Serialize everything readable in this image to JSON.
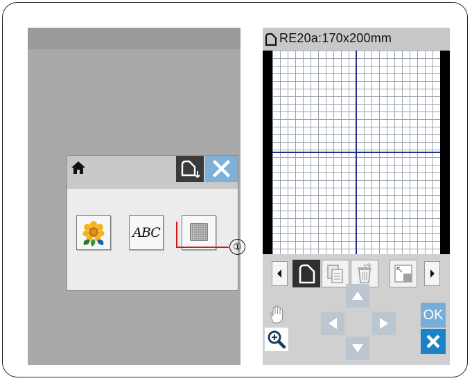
{
  "left_screen": {
    "dialog": {
      "home_icon": "home-icon",
      "hoop_button_icon": "hoop-select-icon",
      "close_button_icon": "close-icon",
      "buttons": [
        {
          "name": "embroidery-pattern",
          "icon": "flower-icon"
        },
        {
          "name": "monogram",
          "label": "ABC"
        },
        {
          "name": "grid-editor",
          "icon": "grid-icon"
        }
      ]
    },
    "callout": {
      "number": "①"
    }
  },
  "right_screen": {
    "title": "RE20a:170x200mm",
    "title_icon": "hoop-icon",
    "toolbar": {
      "prev_icon": "triangle-left-icon",
      "next_icon": "triangle-right-icon",
      "buttons": [
        "hoop-icon",
        "copy-icon",
        "delete-icon",
        "resize-icon"
      ]
    },
    "controls": {
      "hand_icon": "hand-icon",
      "zoom_icon": "zoom-in-icon",
      "ok_label": "OK",
      "cancel_icon": "close-icon"
    }
  },
  "colors": {
    "left_bg": "#a9a9a9",
    "grid_line": "#9aa3ad",
    "grid_axis": "#1f2f8a",
    "ok_bg": "#77aed8",
    "cancel_bg": "#1a82c9",
    "callout_line": "#d01818"
  }
}
